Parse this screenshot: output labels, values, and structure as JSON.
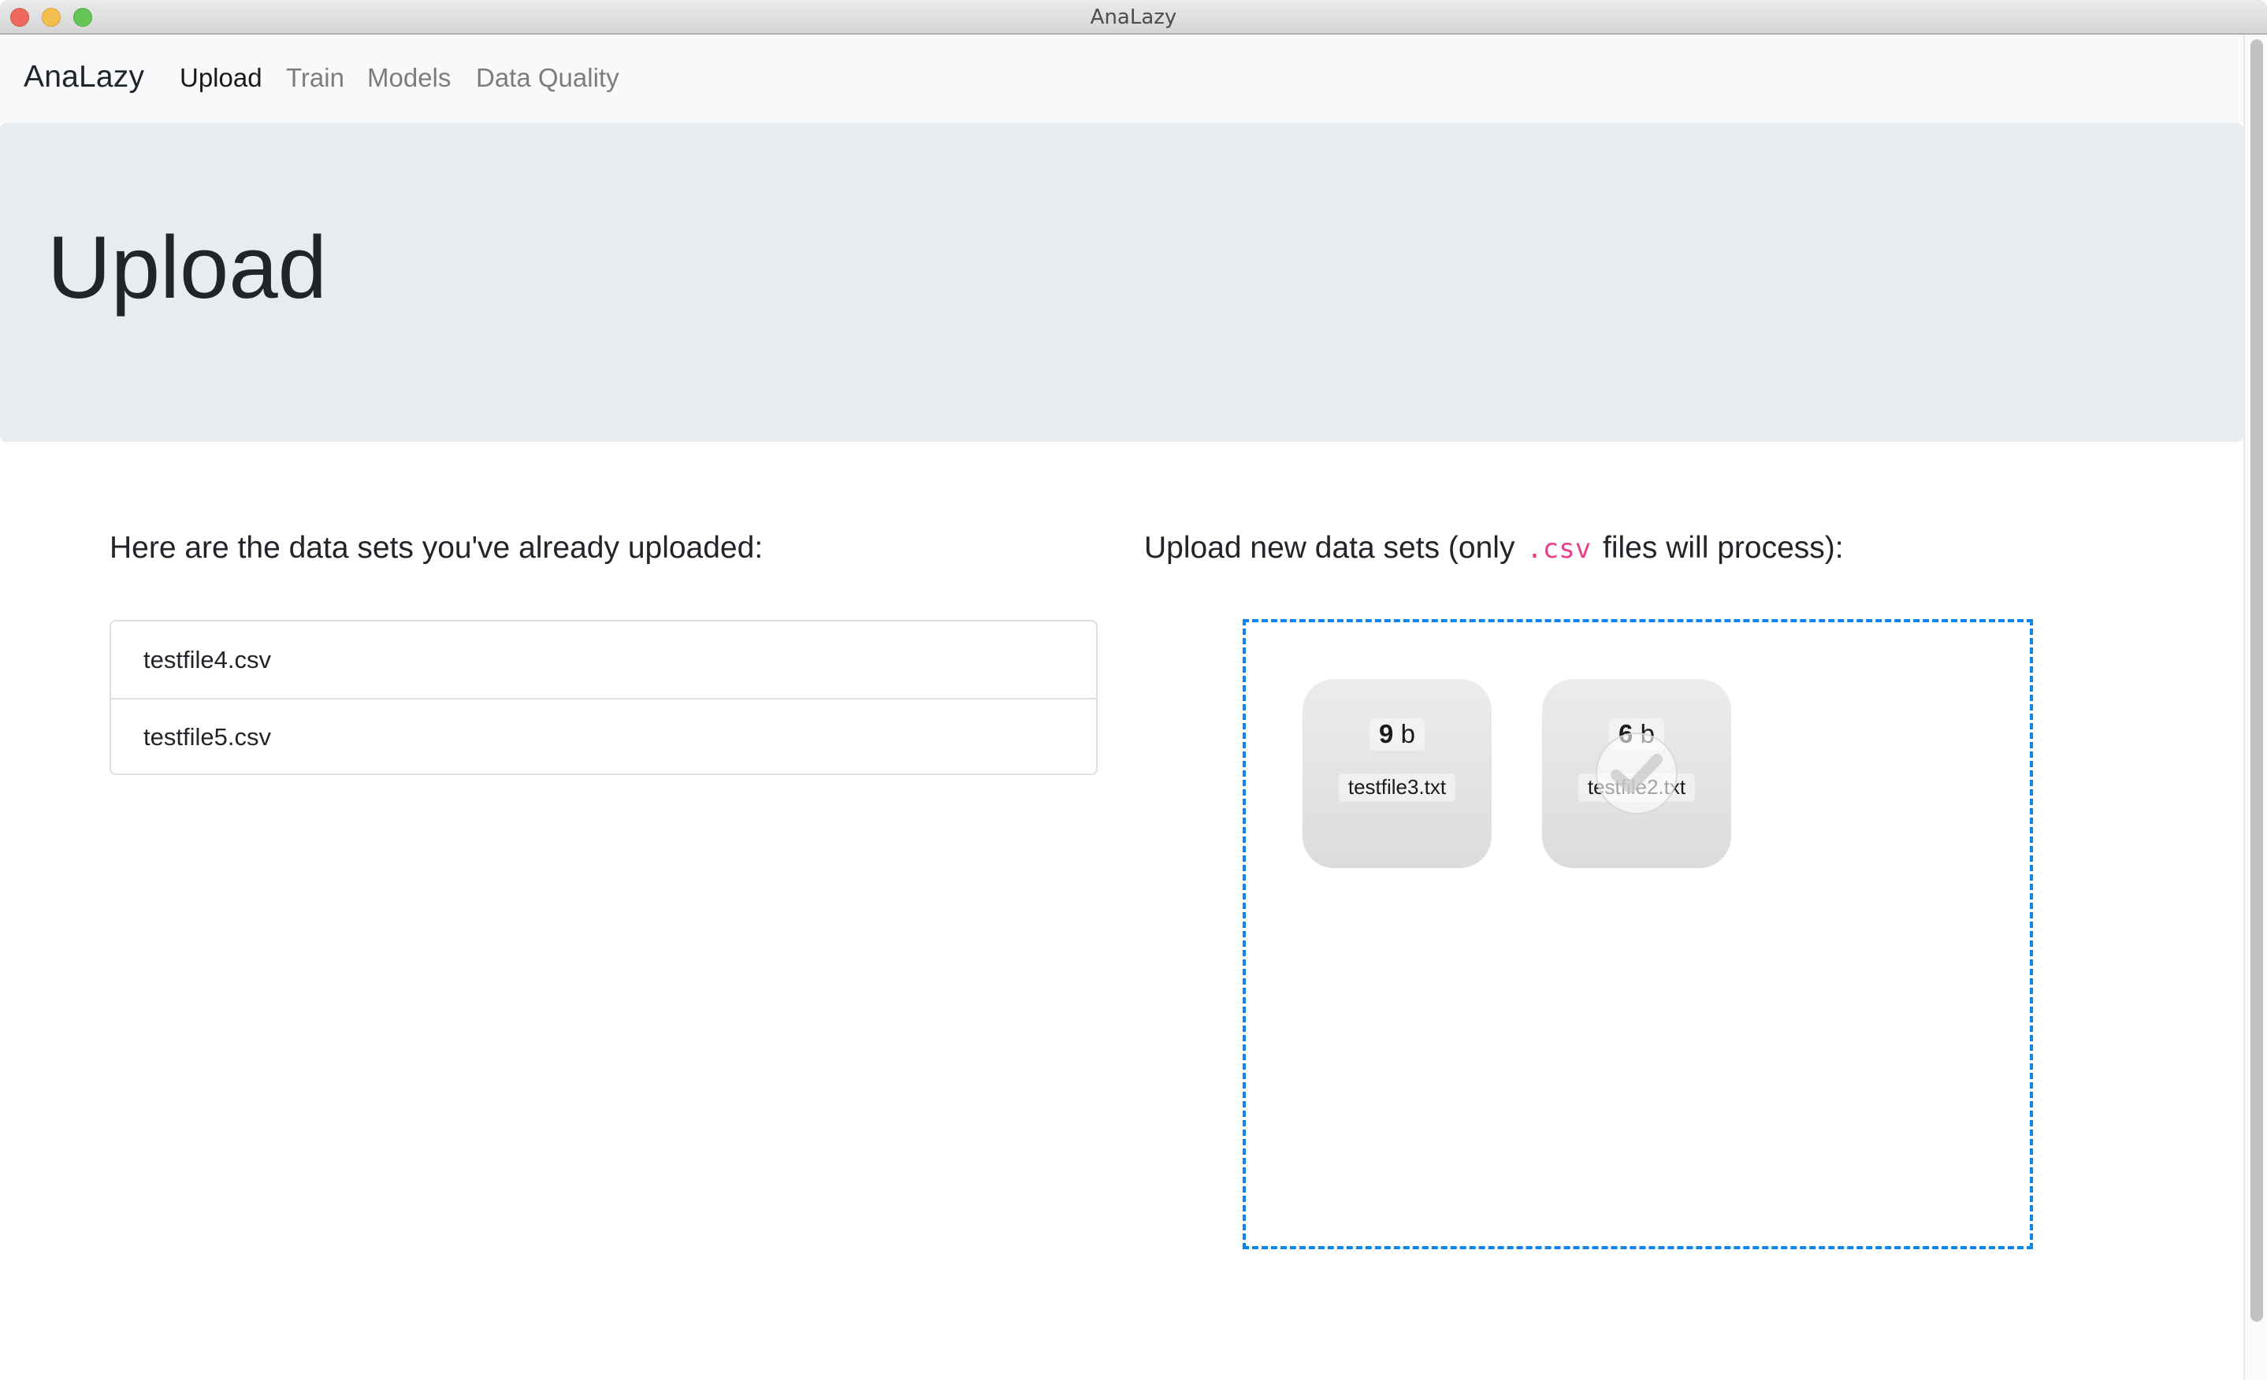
{
  "window": {
    "title": "AnaLazy",
    "controls": [
      "close",
      "minimize",
      "zoom"
    ]
  },
  "navbar": {
    "brand": "AnaLazy",
    "items": [
      {
        "label": "Upload",
        "active": true
      },
      {
        "label": "Train",
        "active": false
      },
      {
        "label": "Models",
        "active": false
      },
      {
        "label": "Data Quality",
        "active": false
      }
    ]
  },
  "jumbotron": {
    "title": "Upload"
  },
  "uploaded": {
    "heading": "Here are the data sets you've already uploaded:",
    "files": [
      "testfile4.csv",
      "testfile5.csv"
    ]
  },
  "upload_new": {
    "heading_prefix": "Upload new data sets (only",
    "heading_code": ".csv",
    "heading_suffix": "files will process):",
    "previews": [
      {
        "size_value": "9",
        "size_unit": "b",
        "filename": "testfile3.txt",
        "status": "uploaded"
      },
      {
        "size_value": "6",
        "size_unit": "b",
        "filename": "testfile2.txt",
        "status": "success",
        "icon": "checkmark-icon"
      }
    ]
  },
  "colors": {
    "dropzone_border": "#0d84ef",
    "code": "#e83e8c",
    "jumbotron_bg": "#e9ecef",
    "navbar_bg": "#f8f9fa"
  }
}
